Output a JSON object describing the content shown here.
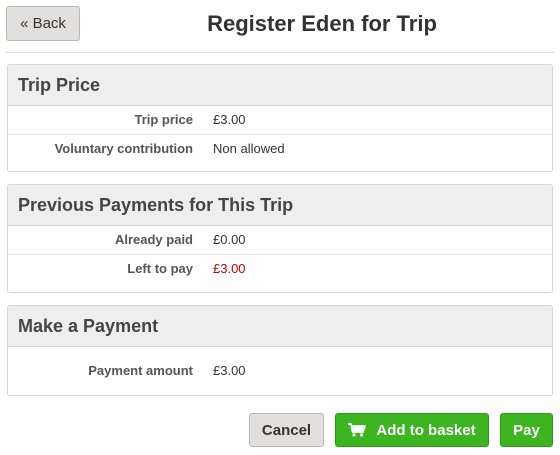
{
  "header": {
    "back_label": "« Back",
    "title": "Register Eden for Trip"
  },
  "trip_price": {
    "heading": "Trip Price",
    "rows": [
      {
        "label": "Trip price",
        "value": "£3.00"
      },
      {
        "label": "Voluntary contribution",
        "value": "Non allowed"
      }
    ]
  },
  "previous_payments": {
    "heading": "Previous Payments for This Trip",
    "rows": [
      {
        "label": "Already paid",
        "value": "£0.00"
      },
      {
        "label": "Left to pay",
        "value": "£3.00"
      }
    ]
  },
  "make_payment": {
    "heading": "Make a Payment",
    "rows": [
      {
        "label": "Payment amount",
        "value": "£3.00"
      }
    ]
  },
  "actions": {
    "cancel_label": "Cancel",
    "add_to_basket_label": "Add to basket",
    "pay_label": "Pay",
    "cart_icon": "shopping-cart-icon"
  },
  "colors": {
    "success_green": "#3cb521",
    "danger_red": "#cc0000",
    "panel_header_bg": "#eeeeee"
  }
}
